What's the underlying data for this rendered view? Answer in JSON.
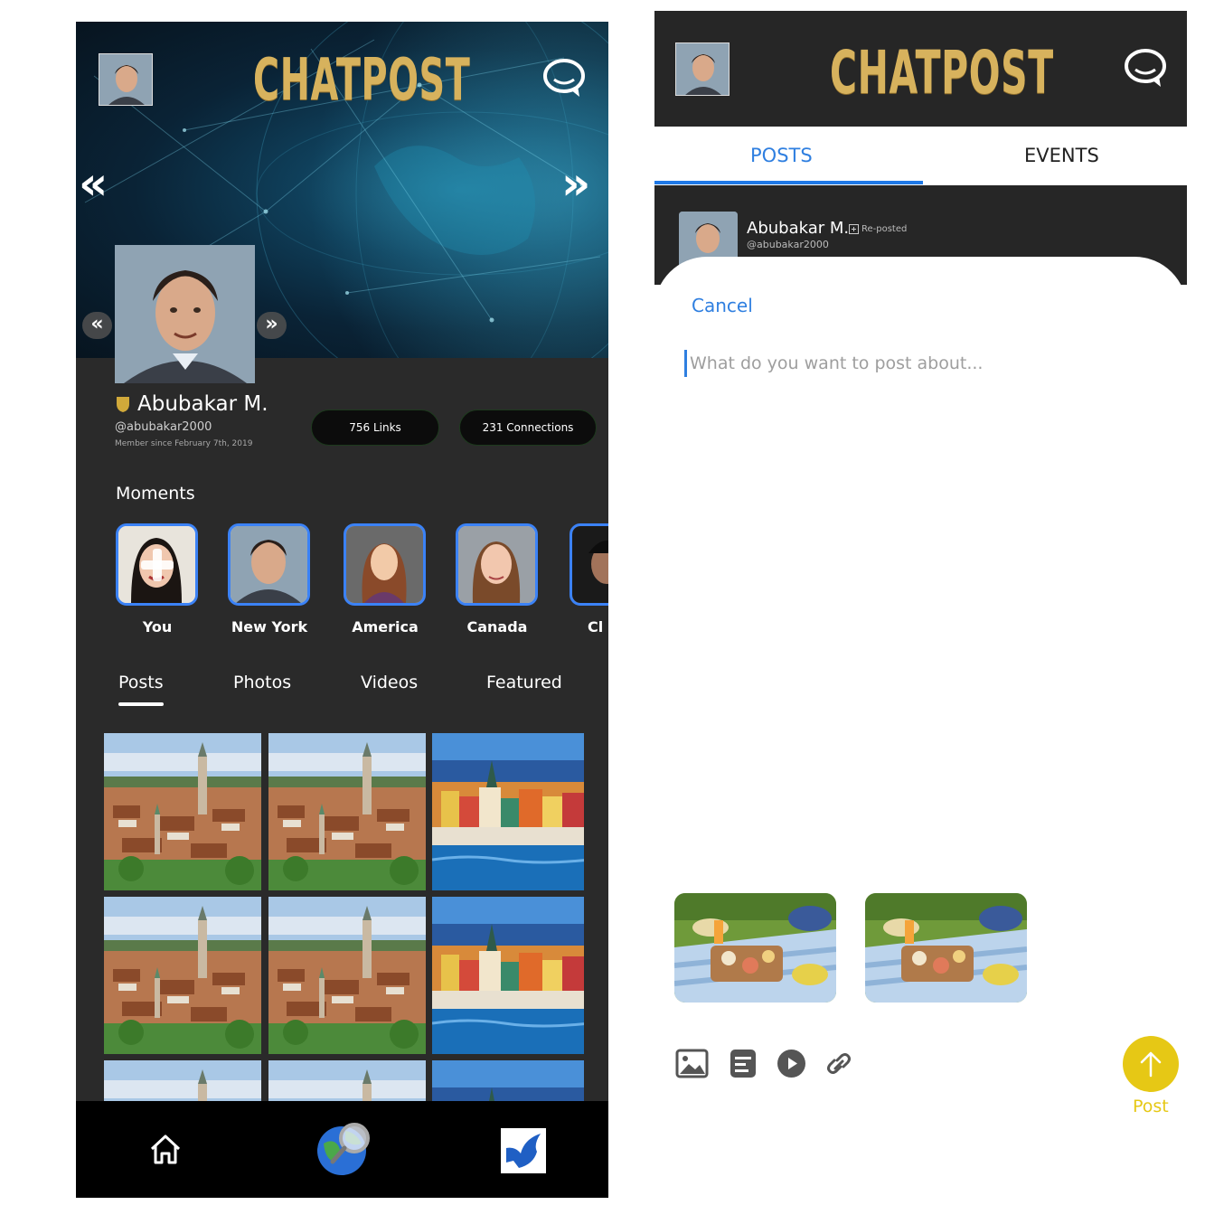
{
  "brand": "CHATPOST",
  "colors": {
    "accent_blue": "#2f7fe0",
    "brand_gold": "#d7b25d",
    "post_button": "#e6c815",
    "moment_border": "#3b82f6",
    "dark_bg": "#2a2a2a"
  },
  "left": {
    "header": {
      "avatar_icon": "user-avatar",
      "chat_icon": "chat-bubble-icon",
      "prev_icon": "double-chevron-left-icon",
      "next_icon": "double-chevron-right-icon"
    },
    "profile": {
      "name": "Abubakar M.",
      "handle": "@abubakar2000",
      "member_since": "Member since February 7th, 2019",
      "links": "756 Links",
      "connections": "231 Connections"
    },
    "moments": {
      "title": "Moments",
      "items": [
        {
          "label": "You"
        },
        {
          "label": "New York"
        },
        {
          "label": "America"
        },
        {
          "label": "Canada"
        },
        {
          "label": "Cl"
        }
      ]
    },
    "tabs": [
      "Posts",
      "Photos",
      "Videos",
      "Featured"
    ],
    "active_tab": "Posts",
    "bottom_nav": [
      "home-icon",
      "globe-search-icon",
      "dove-icon"
    ]
  },
  "right": {
    "tabs": {
      "posts": "POSTS",
      "events": "EVENTS"
    },
    "feed": {
      "name": "Abubakar M.",
      "repost": "Re-posted",
      "handle": "@abubakar2000"
    },
    "composer": {
      "cancel": "Cancel",
      "placeholder": "What do you want to post about...",
      "post_label": "Post",
      "tools": [
        "image-icon",
        "document-icon",
        "play-icon",
        "link-icon"
      ]
    }
  }
}
